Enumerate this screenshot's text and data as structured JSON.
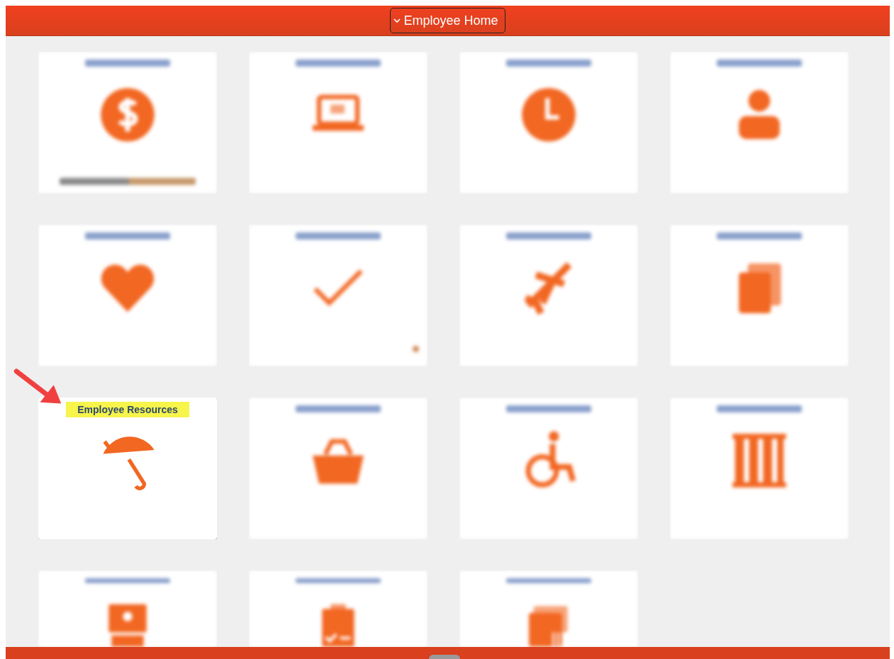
{
  "header": {
    "title": "Employee Home"
  },
  "tiles": [
    {
      "kind": "dollar",
      "blurred": true,
      "footnote": true,
      "badge": false
    },
    {
      "kind": "laptop",
      "blurred": true,
      "footnote": false,
      "badge": false
    },
    {
      "kind": "clock",
      "blurred": true,
      "footnote": false,
      "badge": false
    },
    {
      "kind": "person",
      "blurred": true,
      "footnote": false,
      "badge": false
    },
    {
      "kind": "heart",
      "blurred": true,
      "footnote": false,
      "badge": false
    },
    {
      "kind": "check",
      "blurred": true,
      "footnote": false,
      "badge": true
    },
    {
      "kind": "plane",
      "blurred": true,
      "footnote": false,
      "badge": false
    },
    {
      "kind": "stack",
      "blurred": true,
      "footnote": false,
      "badge": false
    },
    {
      "kind": "umbrella",
      "blurred": false,
      "title": "Employee Resources",
      "highlighted": true,
      "footnote": false,
      "badge": false
    },
    {
      "kind": "basket",
      "blurred": true,
      "footnote": false,
      "badge": false
    },
    {
      "kind": "wheelchair",
      "blurred": true,
      "footnote": false,
      "badge": false
    },
    {
      "kind": "columns",
      "blurred": true,
      "footnote": false,
      "badge": false
    },
    {
      "kind": "idcard",
      "blurred": true,
      "footnote": false,
      "badge": false
    },
    {
      "kind": "clipboard",
      "blurred": true,
      "footnote": false,
      "badge": false
    },
    {
      "kind": "folder",
      "blurred": true,
      "footnote": false,
      "badge": false
    }
  ]
}
